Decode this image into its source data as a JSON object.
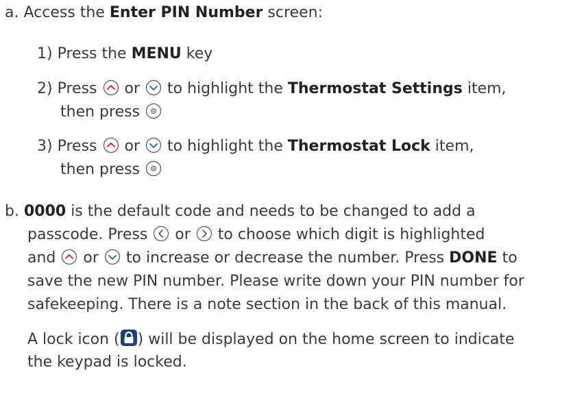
{
  "step_a": {
    "marker": "a.",
    "pre": "Access the ",
    "bold": "Enter PIN Number",
    "post": " screen:"
  },
  "step_1": {
    "marker": "1)",
    "pre": "Press the ",
    "bold": "MENU",
    "post": " key"
  },
  "step_2": {
    "marker": "2)",
    "pre": "Press ",
    "mid": " or ",
    "to": " to highlight the ",
    "bold": "Thermostat Settings",
    "post": " item,",
    "cont": "then press"
  },
  "step_3": {
    "marker": "3)",
    "pre": "Press ",
    "mid": " or ",
    "to": " to highlight the ",
    "bold": "Thermostat Lock",
    "post": " item,",
    "cont": "then press"
  },
  "step_b": {
    "marker": "b.",
    "l1_bold": "0000",
    "l1_rest": " is the default code and needs to be changed to add a",
    "l2_a": "passcode. Press ",
    "l2_b": " or ",
    "l2_c": " to choose which digit is highlighted",
    "l3_a": "and ",
    "l3_b": " or ",
    "l3_c": " to increase or decrease the number. Press ",
    "l3_bold": "DONE",
    "l3_d": " to",
    "l4": "save the new PIN number. Please write down your PIN number for",
    "l5": "safekeeping. There is a note section in the back of this manual."
  },
  "lock_note": {
    "l1_a": "A lock icon (",
    "l1_b": ") will be displayed on the home screen to indicate",
    "l2": "the keypad is locked."
  },
  "icons": {
    "up": "up-arrow-button-icon",
    "down": "down-arrow-button-icon",
    "left": "left-arrow-button-icon",
    "right": "right-arrow-button-icon",
    "select": "select-button-icon",
    "lock": "lock-icon"
  },
  "colors": {
    "text": "#3a3a3a",
    "up_arrow": "#e0323a",
    "down_arrow": "#2a6fb8",
    "lock": "#1f3f7a"
  }
}
